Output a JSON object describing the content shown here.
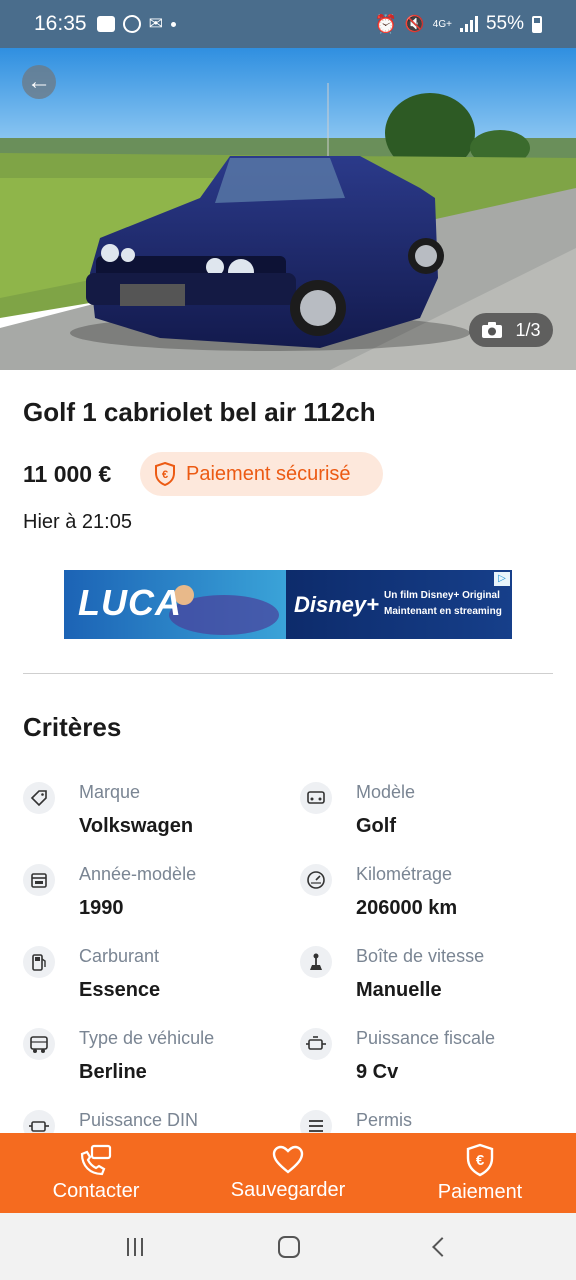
{
  "status_bar": {
    "time": "16:35",
    "network": "4G+",
    "battery": "55%"
  },
  "gallery": {
    "counter": "1/3"
  },
  "listing": {
    "title": "Golf 1 cabriolet bel air 112ch",
    "price": "11 000 €",
    "secure_payment": "Paiement sécurisé",
    "date": "Hier à 21:05"
  },
  "ad": {
    "brand": "LUCA",
    "sponsor": "Disney+",
    "line1": "Un film Disney+ Original",
    "line2": "Maintenant en streaming"
  },
  "criteria": {
    "title": "Critères",
    "items": [
      {
        "label": "Marque",
        "value": "Volkswagen",
        "icon": "tag-icon"
      },
      {
        "label": "Modèle",
        "value": "Golf",
        "icon": "car-model-icon"
      },
      {
        "label": "Année-modèle",
        "value": "1990",
        "icon": "calendar-icon"
      },
      {
        "label": "Kilométrage",
        "value": "206000 km",
        "icon": "speedometer-icon"
      },
      {
        "label": "Carburant",
        "value": "Essence",
        "icon": "fuel-pump-icon"
      },
      {
        "label": "Boîte de vitesse",
        "value": "Manuelle",
        "icon": "gear-stick-icon"
      },
      {
        "label": "Type de véhicule",
        "value": "Berline",
        "icon": "vehicle-type-icon"
      },
      {
        "label": "Puissance fiscale",
        "value": "9 Cv",
        "icon": "engine-icon"
      },
      {
        "label": "Puissance DIN",
        "value": "",
        "icon": "engine-din-icon"
      },
      {
        "label": "Permis",
        "value": "",
        "icon": "license-icon"
      }
    ]
  },
  "actions": {
    "contact": "Contacter",
    "save": "Sauvegarder",
    "payment": "Paiement"
  },
  "colors": {
    "accent": "#f56b1f",
    "status_bar": "#4a6d8c",
    "secure_text": "#ec5a13"
  }
}
